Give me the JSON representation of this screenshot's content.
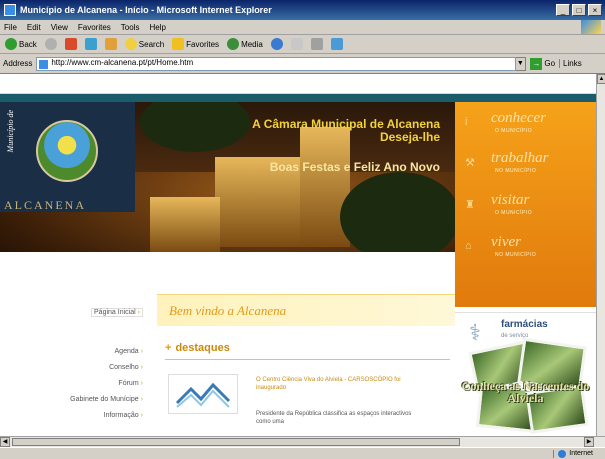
{
  "window": {
    "title": "Município de Alcanena - Início - Microsoft Internet Explorer",
    "controls": [
      "_",
      "□",
      "×"
    ]
  },
  "menubar": [
    "File",
    "Edit",
    "View",
    "Favorites",
    "Tools",
    "Help"
  ],
  "toolbar": {
    "back": "Back",
    "search": "Search",
    "favorites": "Favorites",
    "media": "Media"
  },
  "address": {
    "label": "Address",
    "url": "http://www.cm-alcanena.pt/pt/Home.htm",
    "go": "Go",
    "links": "Links"
  },
  "site": {
    "logo_side_text": "Município de",
    "logo_name": "ALCANENA",
    "greeting_line1": "A Câmara Municipal de Alcanena Deseja-lhe",
    "greeting_line2": "Boas Festas e Feliz Ano Novo",
    "nav": [
      {
        "label": "conhecer",
        "sub": "O MUNICÍPIO"
      },
      {
        "label": "trabalhar",
        "sub": "NO MUNICÍPIO"
      },
      {
        "label": "visitar",
        "sub": "O MUNICÍPIO"
      },
      {
        "label": "viver",
        "sub": "NO MUNICÍPIO"
      }
    ],
    "farmacias": {
      "title": "farmácias",
      "sub": "de serviço"
    },
    "photo_caption": "Conheça as Nascentes do Alviela",
    "welcome": "Bem vindo a Alcanena",
    "destaques": "destaques",
    "news_1": "O Centro Ciência Viva do Alviela - CARSOSCÓPIO foi inaugurado",
    "news_2": "Presidente da República classifica as espaços interactivos como uma",
    "menu": [
      "Página Inicial",
      "Agenda",
      "Conselho",
      "Fórum",
      "Gabinete do Munícipe",
      "Informação"
    ]
  },
  "status": {
    "zone": "Internet"
  }
}
